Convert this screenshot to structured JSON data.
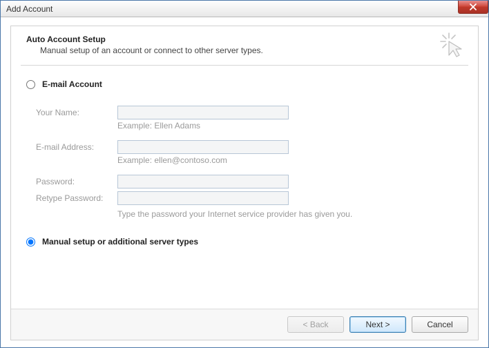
{
  "window": {
    "title": "Add Account"
  },
  "header": {
    "heading": "Auto Account Setup",
    "subtext": "Manual setup of an account or connect to other server types."
  },
  "options": {
    "email_account_label": "E-mail Account",
    "manual_setup_label": "Manual setup or additional server types",
    "selected": "manual"
  },
  "form": {
    "your_name_label": "Your Name:",
    "your_name_value": "",
    "your_name_hint": "Example: Ellen Adams",
    "email_label": "E-mail Address:",
    "email_value": "",
    "email_hint": "Example: ellen@contoso.com",
    "password_label": "Password:",
    "password_value": "",
    "retype_label": "Retype Password:",
    "retype_value": "",
    "password_hint": "Type the password your Internet service provider has given you."
  },
  "buttons": {
    "back": "< Back",
    "next": "Next >",
    "cancel": "Cancel"
  }
}
